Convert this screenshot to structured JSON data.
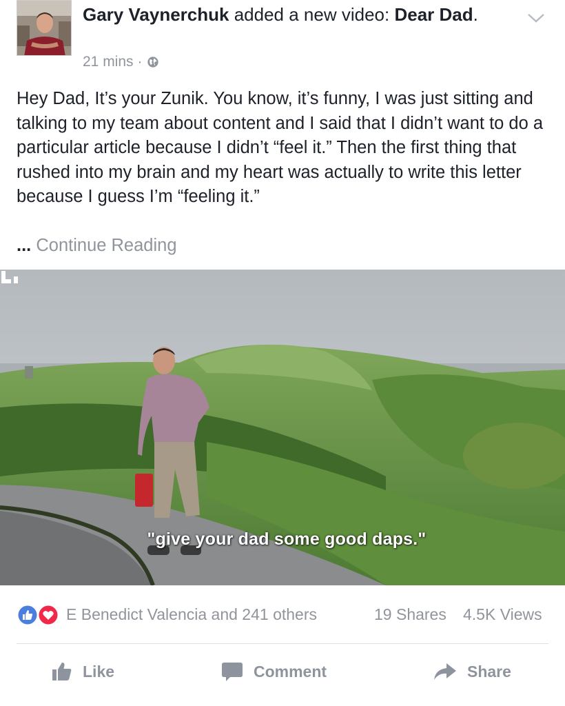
{
  "post": {
    "author": "Gary Vaynerchuk",
    "action_text": "added a new video:",
    "video_title": "Dear Dad",
    "title_end": ".",
    "time": "21 mins",
    "privacy_icon": "globe-icon",
    "menu_icon": "chevron-down-icon",
    "body": "Hey Dad,  It’s your Zunik. You know, it’s funny, I was just sitting and talking to my team about content and I said that I didn’t want to do a particular article because I didn’t “feel it.” Then the first thing that rushed into my brain and my heart was actually to write this letter because I guess I’m “feeling it.”",
    "continue_ellipsis": "...",
    "continue_label": "Continue Reading"
  },
  "video": {
    "caption": "\"give your dad some good daps.\"",
    "watermark_icon": "brand-watermark-icon"
  },
  "stats": {
    "reaction_icons": [
      "like-reaction-icon",
      "love-reaction-icon"
    ],
    "reactions_text": "E Benedict Valencia and 241 others",
    "shares": "19 Shares",
    "views": "4.5K Views"
  },
  "actions": {
    "like": "Like",
    "comment": "Comment",
    "share": "Share"
  },
  "colors": {
    "text": "#1d2129",
    "secondary": "#90949c",
    "like_blue": "#4a7fe0",
    "love_red": "#f0284a",
    "action_gray": "#8d949e"
  }
}
